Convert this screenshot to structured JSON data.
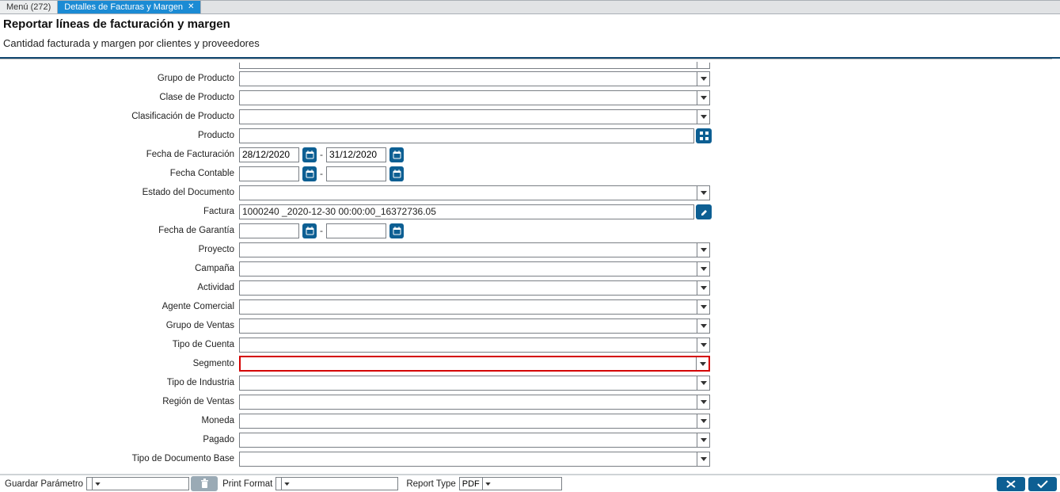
{
  "tabs": {
    "inactive": "Menú (272)",
    "active": "Detalles de Facturas y Margen"
  },
  "header": {
    "title": "Reportar líneas de facturación y margen",
    "subtitle": "Cantidad facturada y margen por clientes y proveedores"
  },
  "fields": {
    "grupo_producto": {
      "label": "Grupo de Producto",
      "value": ""
    },
    "clase_producto": {
      "label": "Clase de Producto",
      "value": ""
    },
    "clasificacion_producto": {
      "label": "Clasificación de Producto",
      "value": ""
    },
    "producto": {
      "label": "Producto",
      "value": ""
    },
    "fecha_facturacion": {
      "label": "Fecha de Facturación",
      "from": "28/12/2020",
      "to": "31/12/2020"
    },
    "fecha_contable": {
      "label": "Fecha Contable",
      "from": "",
      "to": ""
    },
    "estado_documento": {
      "label": "Estado del Documento",
      "value": ""
    },
    "factura": {
      "label": "Factura",
      "value": "1000240 _2020-12-30 00:00:00_16372736.05"
    },
    "fecha_garantia": {
      "label": "Fecha de Garantía",
      "from": "",
      "to": ""
    },
    "proyecto": {
      "label": "Proyecto",
      "value": ""
    },
    "campana": {
      "label": "Campaña",
      "value": ""
    },
    "actividad": {
      "label": "Actividad",
      "value": ""
    },
    "agente_comercial": {
      "label": "Agente Comercial",
      "value": ""
    },
    "grupo_ventas": {
      "label": "Grupo de Ventas",
      "value": ""
    },
    "tipo_cuenta": {
      "label": "Tipo de Cuenta",
      "value": ""
    },
    "segmento": {
      "label": "Segmento",
      "value": ""
    },
    "tipo_industria": {
      "label": "Tipo de Industria",
      "value": ""
    },
    "region_ventas": {
      "label": "Región de Ventas",
      "value": ""
    },
    "moneda": {
      "label": "Moneda",
      "value": ""
    },
    "pagado": {
      "label": "Pagado",
      "value": ""
    },
    "tipo_documento_base": {
      "label": "Tipo de Documento Base",
      "value": ""
    }
  },
  "footer": {
    "guardar_parametro": "Guardar Parámetro",
    "guardar_value": "",
    "print_format": "Print Format",
    "print_format_value": "",
    "report_type": "Report Type",
    "report_type_value": "PDF"
  }
}
